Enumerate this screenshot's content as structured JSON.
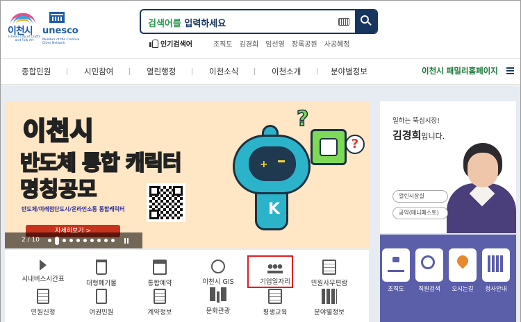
{
  "header": {
    "logo_icheon": {
      "name": "이천시",
      "subtitle": "Icheon City of Crafts and Folk Art"
    },
    "logo_unesco": {
      "word": "unesco",
      "subtitle": "Member of the Creative Cities Network"
    },
    "search": {
      "placeholder_part1": "검색어를 ",
      "placeholder_part2": "입력하세요"
    },
    "popular": {
      "label": "인기검색어",
      "keywords": [
        "조직도",
        "김경희",
        "임선영",
        "장록공원",
        "사공혜정"
      ]
    }
  },
  "nav": {
    "items": [
      "종합민원",
      "시민참여",
      "열린행정",
      "이천소식",
      "이천소개",
      "분야별정보"
    ],
    "family_link": "이천시 패밀리홈페이지"
  },
  "banner": {
    "line1": "이천시",
    "line2": "반도체 통합 캐릭터",
    "line3": "명칭공모",
    "caption": "반도체/미래첨단도시/온라인소통 통합캐릭터",
    "more": "자세히보기 >",
    "pager": "2 / 10",
    "slide_count": 10,
    "active_slide": 2
  },
  "mayor": {
    "greeting": "일하는 뚝심시장!",
    "name": "김경희",
    "suffix": "입니다.",
    "buttons": [
      "열린시장실",
      "공약(매니페스토)"
    ]
  },
  "quick": [
    {
      "label": "조직도",
      "icon": "org-chart-icon"
    },
    {
      "label": "직원검색",
      "icon": "staff-search-icon"
    },
    {
      "label": "오시는길",
      "icon": "map-pin-icon"
    },
    {
      "label": "청사안내",
      "icon": "building-icon"
    }
  ],
  "services": [
    {
      "label": "시내버스시간표",
      "icon": "megaphone-icon"
    },
    {
      "label": "대형폐기물",
      "icon": "trash-icon"
    },
    {
      "label": "통합예약",
      "icon": "calendar-icon"
    },
    {
      "label": "이천시 GIS",
      "icon": "globe-icon"
    },
    {
      "label": "기업일자리",
      "icon": "people-icon"
    },
    {
      "label": "민원사무편람",
      "icon": "book-icon"
    },
    {
      "label": "민원신청",
      "icon": "form-icon"
    },
    {
      "label": "여권민원",
      "icon": "passport-icon"
    },
    {
      "label": "계약정보",
      "icon": "contract-icon"
    },
    {
      "label": "문화관광",
      "icon": "palm-icon"
    },
    {
      "label": "평생교육",
      "icon": "education-icon"
    },
    {
      "label": "분야별정보",
      "icon": "books-icon"
    }
  ],
  "colors": {
    "navy": "#17365f",
    "green": "#2d9a4f",
    "highlight": "#e31b23",
    "quick_bg": "#5b5ea8"
  }
}
